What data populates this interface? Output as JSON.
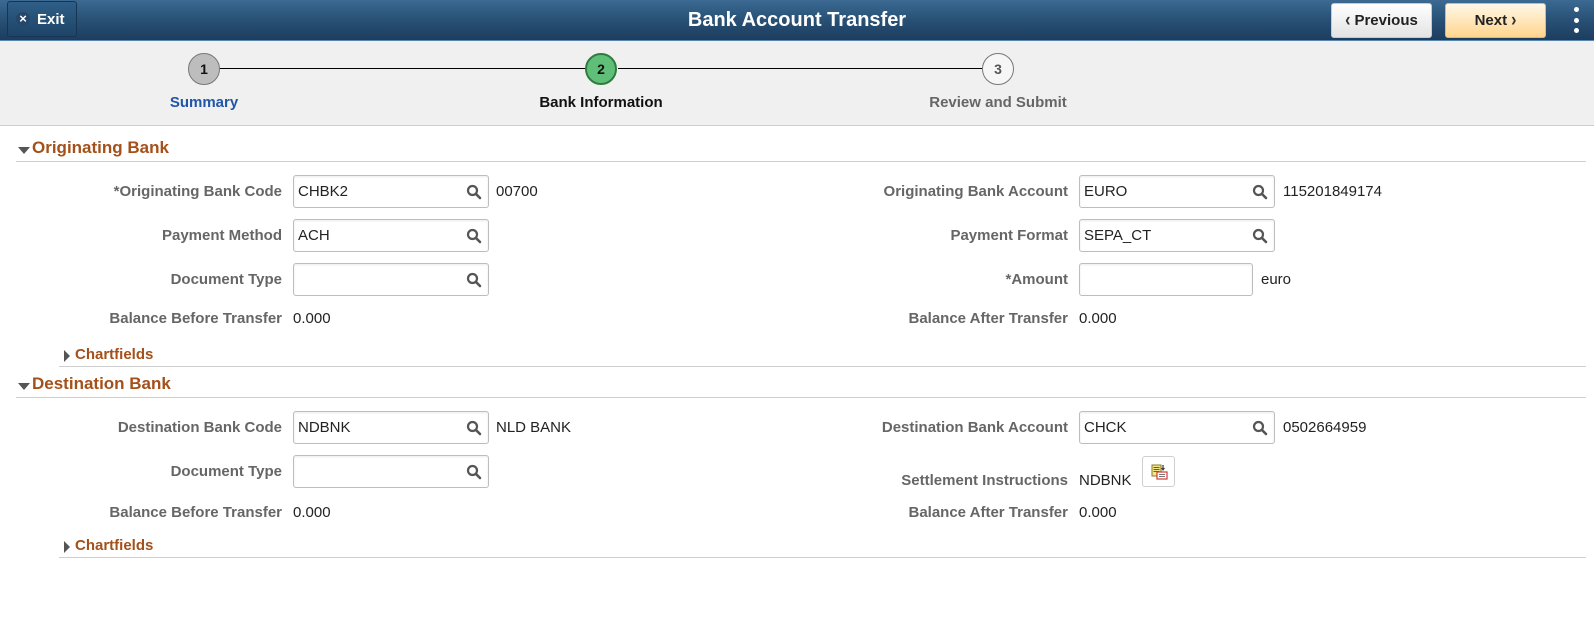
{
  "header": {
    "title": "Bank Account Transfer",
    "exit_label": "Exit",
    "previous_label": "Previous",
    "next_label": "Next"
  },
  "steps": [
    {
      "number": "1",
      "label": "Summary",
      "state": "done"
    },
    {
      "number": "2",
      "label": "Bank Information",
      "state": "active"
    },
    {
      "number": "3",
      "label": "Review and Submit",
      "state": "todo"
    }
  ],
  "originating": {
    "section_title": "Originating Bank",
    "bank_code": {
      "label": "*Originating Bank Code",
      "value": "CHBK2",
      "description": "00700"
    },
    "payment_method": {
      "label": "Payment Method",
      "value": "ACH"
    },
    "document_type": {
      "label": "Document Type",
      "value": ""
    },
    "balance_before": {
      "label": "Balance Before Transfer",
      "value": "0.000"
    },
    "bank_account": {
      "label": "Originating Bank Account",
      "value": "EURO",
      "description": "115201849174"
    },
    "payment_format": {
      "label": "Payment Format",
      "value": "SEPA_CT"
    },
    "amount": {
      "label": "*Amount",
      "value": "",
      "currency": "euro"
    },
    "balance_after": {
      "label": "Balance After Transfer",
      "value": "0.000"
    },
    "chartfields_label": "Chartfields"
  },
  "destination": {
    "section_title": "Destination Bank",
    "bank_code": {
      "label": "Destination Bank Code",
      "value": "NDBNK",
      "description": "NLD BANK"
    },
    "document_type": {
      "label": "Document Type",
      "value": ""
    },
    "balance_before": {
      "label": "Balance Before Transfer",
      "value": "0.000"
    },
    "bank_account": {
      "label": "Destination Bank Account",
      "value": "CHCK",
      "description": "0502664959"
    },
    "settlement": {
      "label": "Settlement Instructions",
      "value": "NDBNK"
    },
    "balance_after": {
      "label": "Balance After Transfer",
      "value": "0.000"
    },
    "chartfields_label": "Chartfields"
  }
}
